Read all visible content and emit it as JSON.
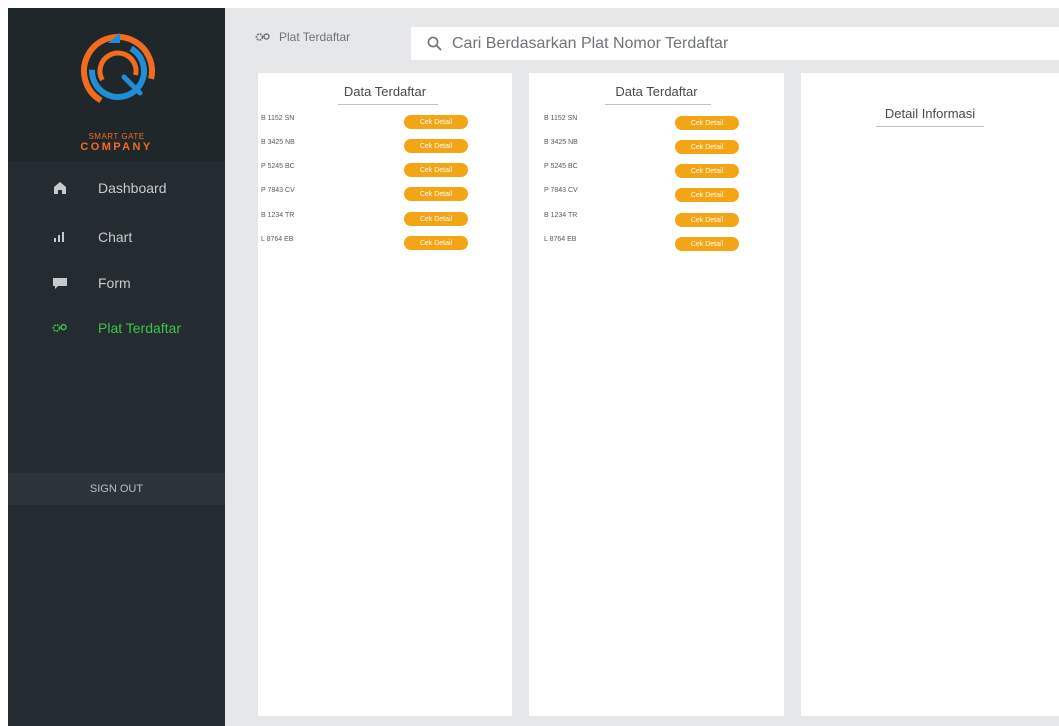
{
  "brand": {
    "line1": "SMART GATE",
    "line2": "COMPANY",
    "color_primary": "#f26b1f",
    "color_secondary": "#1f8ed6"
  },
  "sidebar": {
    "items": [
      {
        "label": "Dashboard",
        "icon": "home-icon"
      },
      {
        "label": "Chart",
        "icon": "bar-chart-icon"
      },
      {
        "label": "Form",
        "icon": "message-icon"
      },
      {
        "label": "Plat Terdaftar",
        "icon": "gears-icon",
        "active": true
      }
    ],
    "signout_label": "SIGN OUT",
    "active_color": "#3ec14a"
  },
  "header": {
    "breadcrumb": "Plat Terdaftar",
    "search_placeholder": "Cari Berdasarkan Plat Nomor Terdaftar"
  },
  "panels": {
    "left": {
      "title": "Data Terdaftar",
      "rows": [
        {
          "plate": "B 1152 SN",
          "button": "Cek Detail"
        },
        {
          "plate": "B 3425 NB",
          "button": "Cek Detail"
        },
        {
          "plate": "P 5245 BC",
          "button": "Cek Detail"
        },
        {
          "plate": "P 7843 CV",
          "button": "Cek Detail"
        },
        {
          "plate": "B 1234 TR",
          "button": "Cek Detail"
        },
        {
          "plate": "L 8764 EB",
          "button": "Cek Detail"
        }
      ]
    },
    "middle": {
      "title": "Data Terdaftar",
      "rows": [
        {
          "plate": "B 1152 SN",
          "button": "Cek Detail"
        },
        {
          "plate": "B 3425 NB",
          "button": "Cek Detail"
        },
        {
          "plate": "P 5245 BC",
          "button": "Cek Detail"
        },
        {
          "plate": "P 7843 CV",
          "button": "Cek Detail"
        },
        {
          "plate": "B 1234 TR",
          "button": "Cek Detail"
        },
        {
          "plate": "L 8764 EB",
          "button": "Cek Detail"
        }
      ]
    },
    "right": {
      "title": "Detail Informasi"
    }
  },
  "colors": {
    "button": "#f4a516",
    "sidebar_bg": "#252c31",
    "main_bg": "#e6e7e9"
  }
}
